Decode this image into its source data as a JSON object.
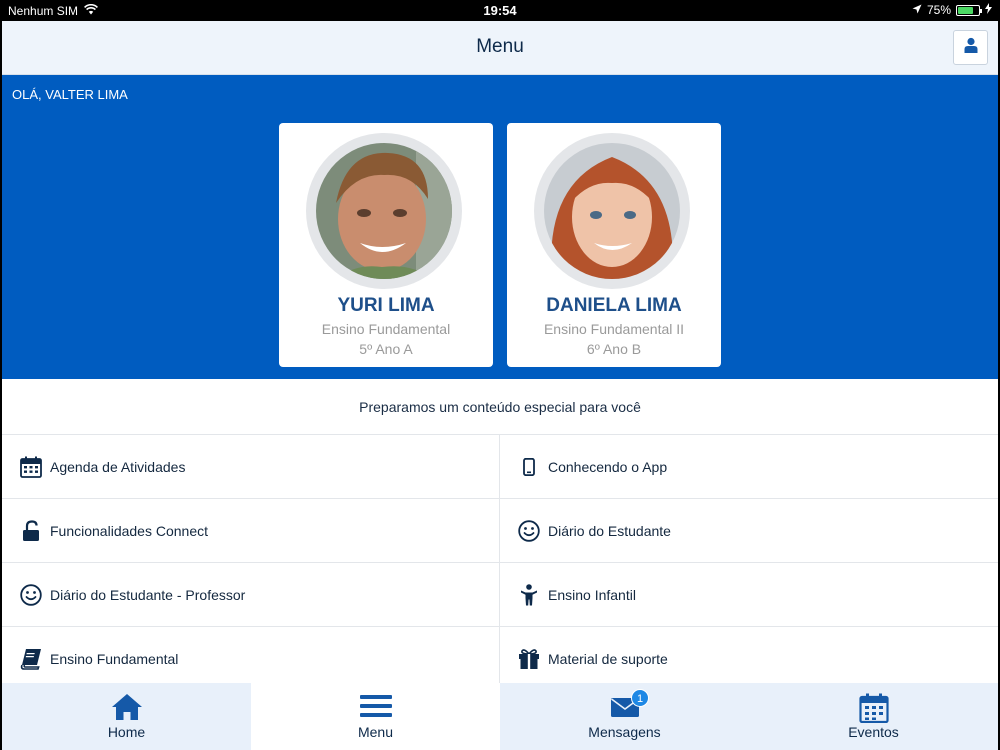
{
  "status_bar": {
    "carrier": "Nenhum SIM",
    "time": "19:54",
    "battery_percent": "75%",
    "battery_level": 0.75,
    "icons": [
      "wifi-icon",
      "location-arrow-icon",
      "battery-icon",
      "charging-bolt-icon"
    ]
  },
  "header": {
    "title": "Menu",
    "profile_icon": "user-icon"
  },
  "hero": {
    "greeting": "OLÁ, VALTER LIMA",
    "students": [
      {
        "name": "YURI LIMA",
        "level": "Ensino Fundamental",
        "class": "5º Ano A"
      },
      {
        "name": "DANIELA LIMA",
        "level": "Ensino Fundamental II",
        "class": "6º Ano B"
      }
    ]
  },
  "intro": {
    "text": "Preparamos um conteúdo especial para você"
  },
  "menu": {
    "items": [
      {
        "label": "Agenda de Atividades",
        "icon": "calendar-icon"
      },
      {
        "label": "Conhecendo o App",
        "icon": "phone-icon"
      },
      {
        "label": "Funcionalidades Connect",
        "icon": "unlock-icon"
      },
      {
        "label": "Diário do Estudante",
        "icon": "smile-icon"
      },
      {
        "label": "Diário do Estudante - Professor",
        "icon": "smile-icon"
      },
      {
        "label": "Ensino Infantil",
        "icon": "child-icon"
      },
      {
        "label": "Ensino Fundamental",
        "icon": "book-icon"
      },
      {
        "label": "Material de suporte",
        "icon": "gift-icon"
      }
    ]
  },
  "tabs": [
    {
      "label": "Home",
      "icon": "home-icon"
    },
    {
      "label": "Menu",
      "icon": "hamburger-icon"
    },
    {
      "label": "Mensagens",
      "icon": "envelope-icon",
      "badge": "1"
    },
    {
      "label": "Eventos",
      "icon": "calendar-icon"
    }
  ],
  "colors": {
    "primary_blue": "#005cc0",
    "dark_navy": "#1e4f8a",
    "badge_blue": "#1e88e5",
    "tab_bg": "#e8f0fa"
  }
}
